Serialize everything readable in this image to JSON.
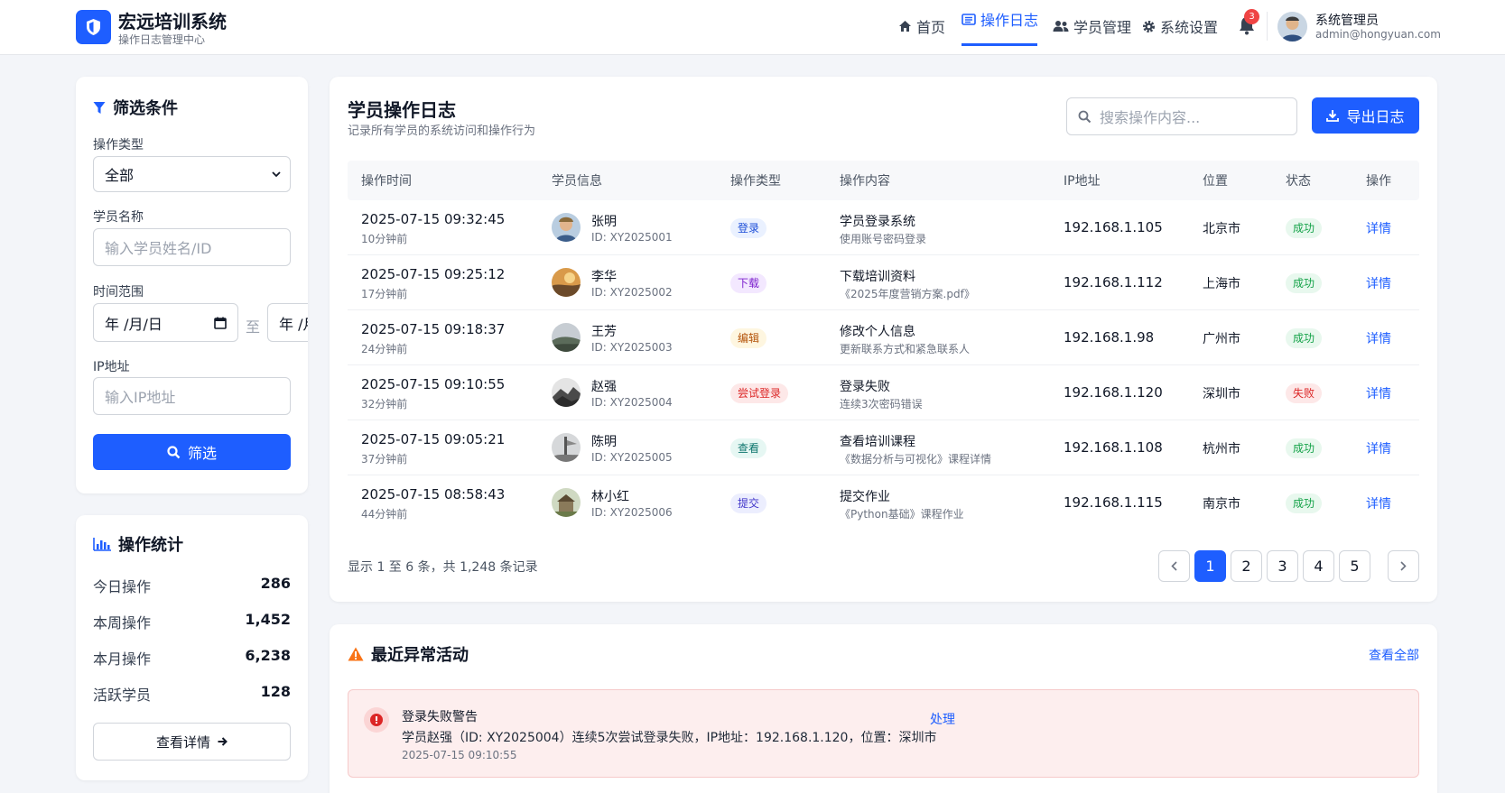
{
  "header": {
    "brand_title": "宏远培训系统",
    "brand_subtitle": "操作日志管理中心",
    "nav": [
      {
        "label": "首页",
        "icon": "home-icon",
        "active": false
      },
      {
        "label": "操作日志",
        "icon": "list-icon",
        "active": true
      },
      {
        "label": "学员管理",
        "icon": "users-icon",
        "active": false
      },
      {
        "label": "系统设置",
        "icon": "gear-icon",
        "active": false
      }
    ],
    "notification_count": "3",
    "user_name": "系统管理员",
    "user_email": "admin@hongyuan.com"
  },
  "filter": {
    "title": "筛选条件",
    "op_type_label": "操作类型",
    "op_type_value": "全部",
    "student_label": "学员名称",
    "student_placeholder": "输入学员姓名/ID",
    "time_label": "时间范围",
    "date_start": "年 /月/日",
    "date_sep": "至",
    "date_end": "年 /月/日",
    "ip_label": "IP地址",
    "ip_placeholder": "输入IP地址",
    "button": "筛选"
  },
  "stats": {
    "title": "操作统计",
    "items": [
      {
        "label": "今日操作",
        "value": "286"
      },
      {
        "label": "本周操作",
        "value": "1,452"
      },
      {
        "label": "本月操作",
        "value": "6,238"
      },
      {
        "label": "活跃学员",
        "value": "128"
      }
    ],
    "button": "查看详情"
  },
  "log": {
    "title": "学员操作日志",
    "subtitle": "记录所有学员的系统访问和操作行为",
    "search_placeholder": "搜索操作内容...",
    "export_label": "导出日志",
    "columns": [
      "操作时间",
      "学员信息",
      "操作类型",
      "操作内容",
      "IP地址",
      "位置",
      "状态",
      "操作"
    ],
    "rows": [
      {
        "time": "2025-07-15 09:32:45",
        "ago": "10分钟前",
        "name": "张明",
        "id": "ID: XY2025001",
        "type": "登录",
        "type_color": "#1d4ed8",
        "type_bg": "#eaf1ff",
        "op": "学员登录系统",
        "op_sub": "使用账号密码登录",
        "ip": "192.168.1.105",
        "loc": "北京市",
        "status": "成功",
        "status_color": "#16a34a",
        "status_bg": "#e8f8ee",
        "action": "详情"
      },
      {
        "time": "2025-07-15 09:25:12",
        "ago": "17分钟前",
        "name": "李华",
        "id": "ID: XY2025002",
        "type": "下载",
        "type_color": "#7e22ce",
        "type_bg": "#f3e8ff",
        "op": "下载培训资料",
        "op_sub": "《2025年度营销方案.pdf》",
        "ip": "192.168.1.112",
        "loc": "上海市",
        "status": "成功",
        "status_color": "#16a34a",
        "status_bg": "#e8f8ee",
        "action": "详情"
      },
      {
        "time": "2025-07-15 09:18:37",
        "ago": "24分钟前",
        "name": "王芳",
        "id": "ID: XY2025003",
        "type": "编辑",
        "type_color": "#b45309",
        "type_bg": "#fef6e0",
        "op": "修改个人信息",
        "op_sub": "更新联系方式和紧急联系人",
        "ip": "192.168.1.98",
        "loc": "广州市",
        "status": "成功",
        "status_color": "#16a34a",
        "status_bg": "#e8f8ee",
        "action": "详情"
      },
      {
        "time": "2025-07-15 09:10:55",
        "ago": "32分钟前",
        "name": "赵强",
        "id": "ID: XY2025004",
        "type": "尝试登录",
        "type_color": "#dc2626",
        "type_bg": "#fde8e8",
        "op": "登录失败",
        "op_sub": "连续3次密码错误",
        "ip": "192.168.1.120",
        "loc": "深圳市",
        "status": "失败",
        "status_color": "#dc2626",
        "status_bg": "#fde8e8",
        "action": "详情"
      },
      {
        "time": "2025-07-15 09:05:21",
        "ago": "37分钟前",
        "name": "陈明",
        "id": "ID: XY2025005",
        "type": "查看",
        "type_color": "#0f766e",
        "type_bg": "#e6f7f3",
        "op": "查看培训课程",
        "op_sub": "《数据分析与可视化》课程详情",
        "ip": "192.168.1.108",
        "loc": "杭州市",
        "status": "成功",
        "status_color": "#16a34a",
        "status_bg": "#e8f8ee",
        "action": "详情"
      },
      {
        "time": "2025-07-15 08:58:43",
        "ago": "44分钟前",
        "name": "林小红",
        "id": "ID: XY2025006",
        "type": "提交",
        "type_color": "#4338ca",
        "type_bg": "#eceefe",
        "op": "提交作业",
        "op_sub": "《Python基础》课程作业",
        "ip": "192.168.1.115",
        "loc": "南京市",
        "status": "成功",
        "status_color": "#16a34a",
        "status_bg": "#e8f8ee",
        "action": "详情"
      }
    ],
    "summary": "显示 1 至 6 条，共 1,248 条记录",
    "pages": [
      "1",
      "2",
      "3",
      "4",
      "5"
    ],
    "active_page": "1"
  },
  "alerts": {
    "title": "最近异常活动",
    "view_all": "查看全部",
    "items": [
      {
        "title": "登录失败警告",
        "desc": "学员赵强（ID: XY2025004）连续5次尝试登录失败，IP地址：192.168.1.120，位置：深圳市",
        "time": "2025-07-15 09:10:55",
        "action": "处理"
      }
    ]
  },
  "colors": {
    "accent": "#1e5eff",
    "danger": "#ef4444",
    "warning": "#f97316"
  }
}
